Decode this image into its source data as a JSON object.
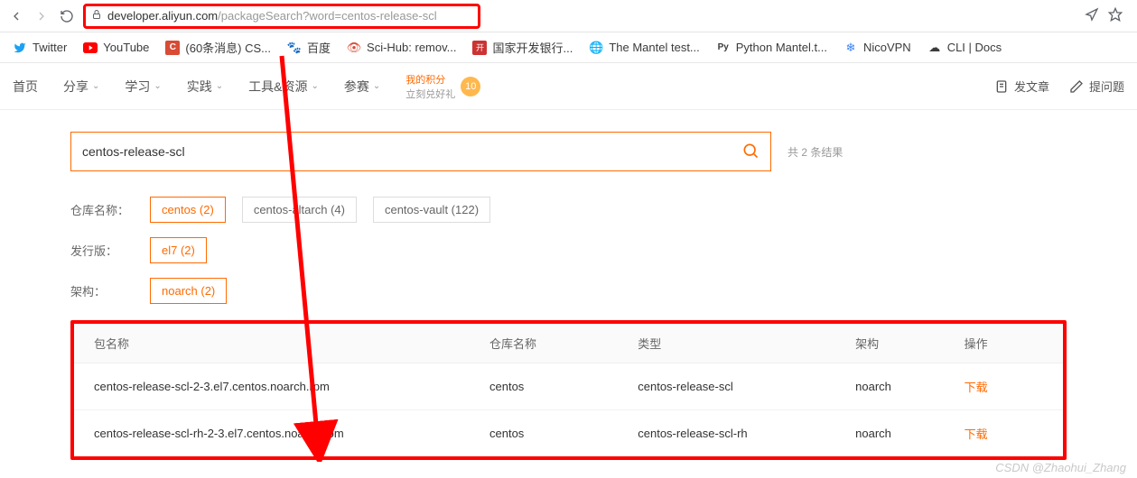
{
  "chrome": {
    "url_host": "developer.aliyun.com",
    "url_path": "/packageSearch?word=centos-release-scl"
  },
  "bookmarks": [
    {
      "label": "Twitter"
    },
    {
      "label": "YouTube"
    },
    {
      "label": "(60条消息) CS..."
    },
    {
      "label": "百度"
    },
    {
      "label": "Sci-Hub: remov..."
    },
    {
      "label": "国家开发银行..."
    },
    {
      "label": "The Mantel test..."
    },
    {
      "label": "Python Mantel.t..."
    },
    {
      "label": "NicoVPN"
    },
    {
      "label": "CLI | Docs"
    }
  ],
  "nav": {
    "items": [
      {
        "label": "首页",
        "dropdown": false
      },
      {
        "label": "分享",
        "dropdown": true
      },
      {
        "label": "学习",
        "dropdown": true
      },
      {
        "label": "实践",
        "dropdown": true
      },
      {
        "label": "工具&资源",
        "dropdown": true
      },
      {
        "label": "参赛",
        "dropdown": true
      }
    ],
    "points_t1": "我的积分",
    "points_t2": "立刻兑好礼",
    "points_num": "10",
    "publish": "发文章",
    "ask": "提问题"
  },
  "search": {
    "value": "centos-release-scl",
    "result_count": "共 2 条结果"
  },
  "filters": {
    "repo_label": "仓库名称：",
    "repo_chips": [
      {
        "label": "centos (2)",
        "active": true
      },
      {
        "label": "centos-altarch (4)",
        "active": false
      },
      {
        "label": "centos-vault (122)",
        "active": false
      }
    ],
    "release_label": "发行版：",
    "release_chips": [
      {
        "label": "el7 (2)",
        "active": true
      }
    ],
    "arch_label": "架构：",
    "arch_chips": [
      {
        "label": "noarch (2)",
        "active": true
      }
    ]
  },
  "table": {
    "headers": [
      "包名称",
      "仓库名称",
      "类型",
      "架构",
      "操作"
    ],
    "rows": [
      {
        "name": "centos-release-scl-2-3.el7.centos.noarch.rpm",
        "repo": "centos",
        "type": "centos-release-scl",
        "arch": "noarch",
        "op": "下载"
      },
      {
        "name": "centos-release-scl-rh-2-3.el7.centos.noarch.rpm",
        "repo": "centos",
        "type": "centos-release-scl-rh",
        "arch": "noarch",
        "op": "下载"
      }
    ]
  },
  "watermark": "CSDN @Zhaohui_Zhang"
}
